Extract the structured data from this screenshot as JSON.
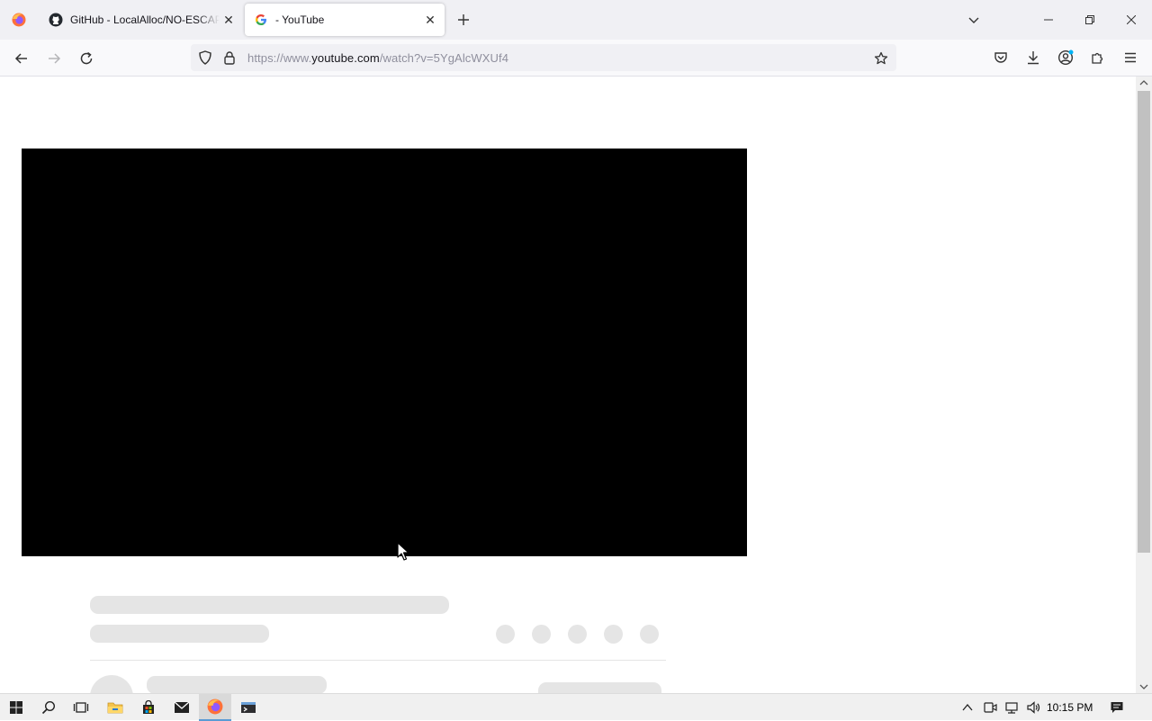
{
  "browser": {
    "tabs": [
      {
        "title": "GitHub - LocalAlloc/NO-ESCAPE",
        "favicon": "github-icon",
        "active": false
      },
      {
        "title": "- YouTube",
        "favicon": "google-g-icon",
        "active": true
      }
    ],
    "url_prefix": "https://www.",
    "url_host": "youtube.com",
    "url_path": "/watch?v=5YgAlcWXUf4",
    "icons": {
      "back": "back-arrow-icon",
      "forward": "forward-arrow-icon",
      "reload": "reload-icon",
      "shield": "tracking-protection-icon",
      "lock": "lock-icon",
      "bookmark": "star-icon",
      "pocket": "pocket-icon",
      "downloads": "download-icon",
      "account": "account-icon",
      "extensions": "extensions-icon",
      "menu": "hamburger-menu-icon"
    }
  },
  "page": {
    "player_color": "#000000",
    "skeleton_color": "#e5e5e5"
  },
  "taskbar": {
    "time": "10:15 PM",
    "apps": [
      "start",
      "search",
      "task-view",
      "file-explorer",
      "microsoft-store",
      "mail",
      "firefox",
      "terminal"
    ]
  }
}
